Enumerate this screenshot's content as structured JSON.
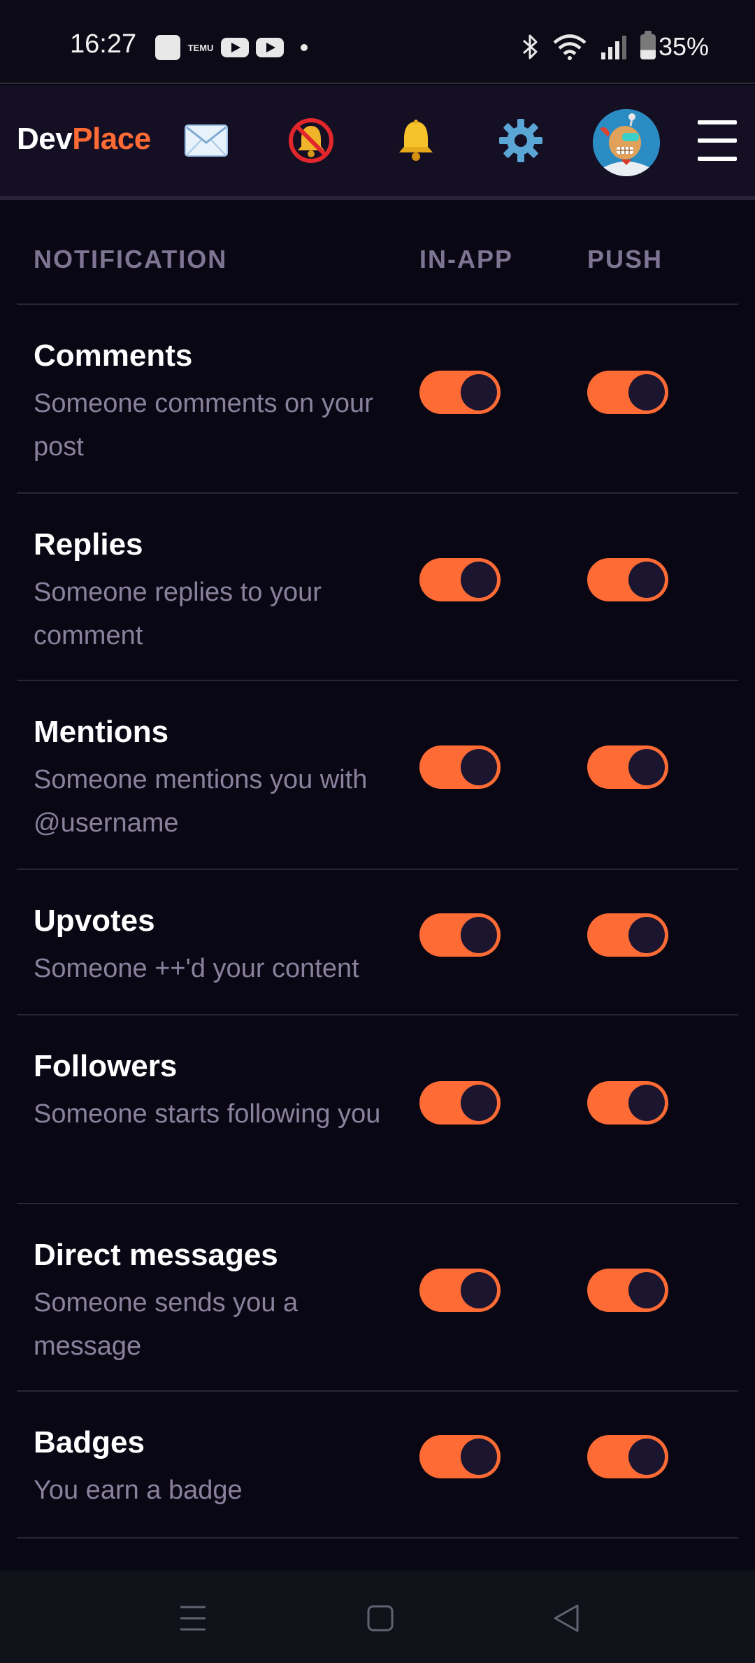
{
  "status_bar": {
    "time": "16:27",
    "temu_label": "TEMU",
    "battery": "35%"
  },
  "header": {
    "logo_dev": "Dev",
    "logo_place": "Place",
    "brand_color": "#ff6b35",
    "icons": [
      "mail-icon",
      "notifications-off-icon",
      "bell-icon",
      "gear-icon",
      "avatar",
      "menu-icon"
    ]
  },
  "table": {
    "headers": {
      "notification": "NOTIFICATION",
      "in_app": "IN-APP",
      "push": "PUSH"
    },
    "rows": [
      {
        "title": "Comments",
        "description": "Someone comments on your post",
        "in_app": true,
        "push": true
      },
      {
        "title": "Replies",
        "description": "Someone replies to your comment",
        "in_app": true,
        "push": true
      },
      {
        "title": "Mentions",
        "description": "Someone mentions you with @username",
        "in_app": true,
        "push": true
      },
      {
        "title": "Upvotes",
        "description": "Someone ++'d your content",
        "in_app": true,
        "push": true
      },
      {
        "title": "Followers",
        "description": "Someone starts following you",
        "in_app": true,
        "push": true
      },
      {
        "title": "Direct messages",
        "description": "Someone sends you a message",
        "in_app": true,
        "push": true
      },
      {
        "title": "Badges",
        "description": "You earn a badge",
        "in_app": true,
        "push": true
      }
    ]
  },
  "toggle_on_color": "#ff6b35"
}
